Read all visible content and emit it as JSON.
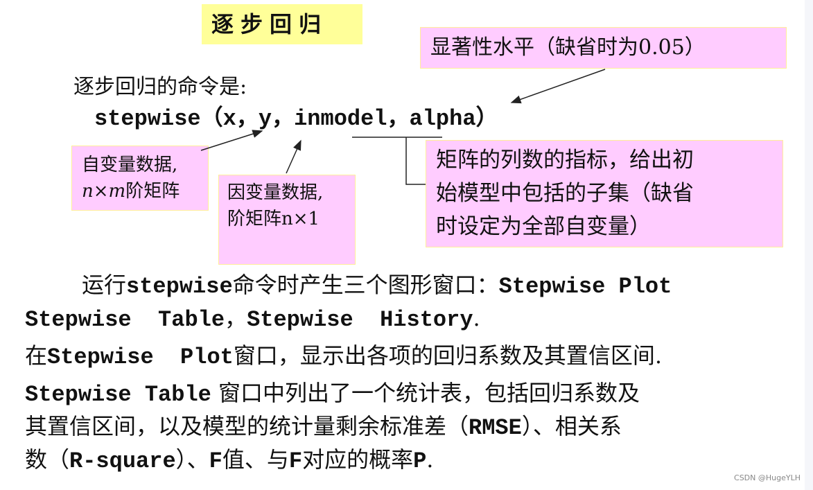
{
  "title": "逐步回归",
  "intro": "逐步回归的命令是:",
  "command": {
    "func": "stepwise",
    "open_paren": "（",
    "arg_x": "x",
    "sep1": "，",
    "arg_y": "y",
    "sep2": "，",
    "arg_inmodel": "inmodel",
    "sep3": "，",
    "arg_alpha": "alpha",
    "close_paren": "）"
  },
  "callouts": {
    "alpha": "显著性水平（缺省时为0.05）",
    "x_line1": "自变量数据,",
    "x_line2_math": "n×m",
    "x_line2_text": "阶矩阵",
    "y_line1": "因变量数据,",
    "y_line2": "阶矩阵n×1",
    "inmodel_line1": "矩阵的列数的指标，给出初",
    "inmodel_line2": "始模型中包括的子集（缺省",
    "inmodel_line3": "时设定为全部自变量）"
  },
  "paragraphs": {
    "p1_a": "运行",
    "p1_b": "stepwise",
    "p1_c": "命令时产生三个图形窗口：",
    "p1_d": "Stepwise Plot",
    "p2_a": "Stepwise  Table",
    "p2_b": "，",
    "p2_c": "Stepwise  History",
    "p2_d": ".",
    "p3_a": "在",
    "p3_b": "Stepwise  Plot",
    "p3_c": "窗口，显示出各项的回归系数及其置信区间.",
    "p4_a": "Stepwise Table",
    "p4_b": " 窗口中列出了一个统计表，包括回归系数及",
    "p5_a": "其置信区间，以及模型的统计量剩余标准差（",
    "p5_b": "RMSE",
    "p5_c": "）、相关系",
    "p6_a": "数（",
    "p6_b": "R-square",
    "p6_c": "）、",
    "p6_d": "F",
    "p6_e": "值、与",
    "p6_f": "F",
    "p6_g": "对应的概率",
    "p6_h": "P",
    "p6_i": "."
  },
  "watermark": "CSDN @HugeYLH",
  "colors": {
    "title_bg": "#ffff99",
    "callout_bg": "#ffccff",
    "callout_border": "#ffee99"
  }
}
